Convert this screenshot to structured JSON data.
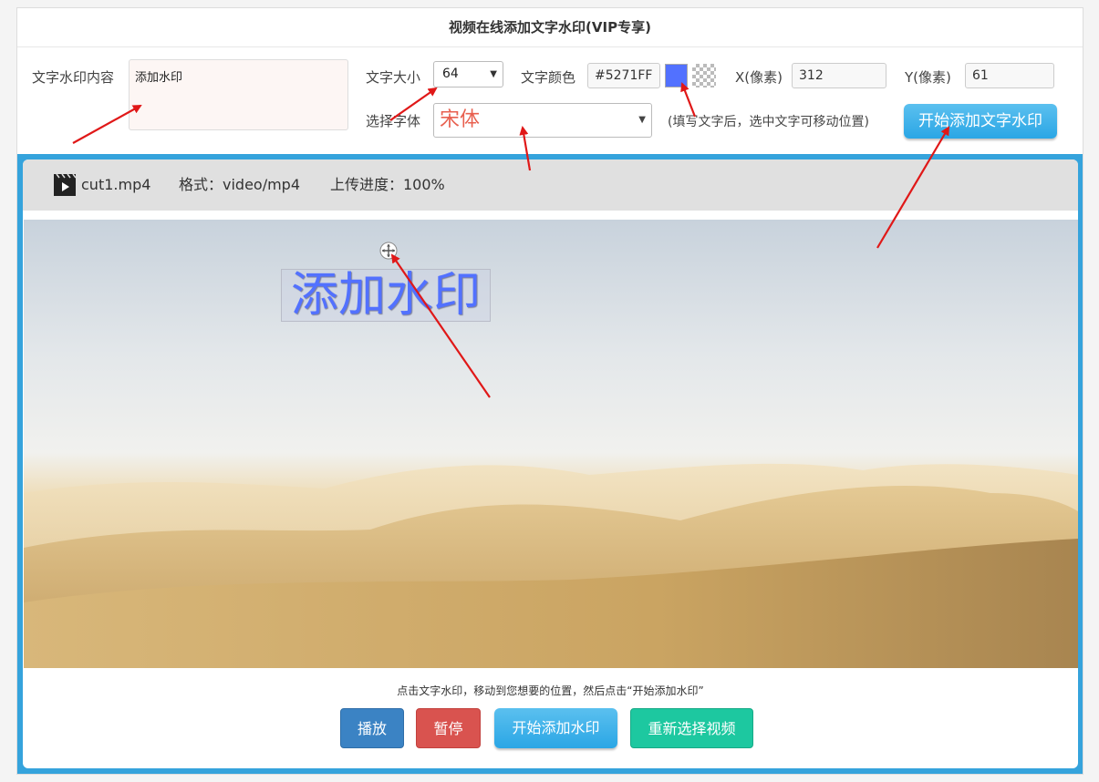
{
  "title": "视频在线添加文字水印(VIP专享)",
  "form": {
    "content_label": "文字水印内容",
    "content_value": "添加水印",
    "size_label": "文字大小",
    "size_value": "64",
    "color_label": "文字颜色",
    "color_value": "#5271FF",
    "x_label": "X(像素)",
    "x_value": "312",
    "y_label": "Y(像素)",
    "y_value": "61",
    "font_label": "选择字体",
    "font_value": "宋体",
    "tip": "(填写文字后，选中文字可移动位置)",
    "start_button": "开始添加文字水印"
  },
  "file": {
    "name": "cut1.mp4",
    "format": "格式：video/mp4",
    "progress": "上传进度：100%"
  },
  "video": {
    "watermark_text": "添加水印",
    "hint": "点击文字水印，移动到您想要的位置，然后点击“开始添加水印”"
  },
  "buttons": {
    "play": "播放",
    "pause": "暂停",
    "add": "开始添加水印",
    "reselect": "重新选择视频"
  },
  "colors": {
    "accent": "#35a3dc",
    "watermark": "#5271FF",
    "play": "#3b83c4",
    "pause": "#d9534f",
    "reselect": "#1dc8a0",
    "annotation": "#e01818"
  }
}
